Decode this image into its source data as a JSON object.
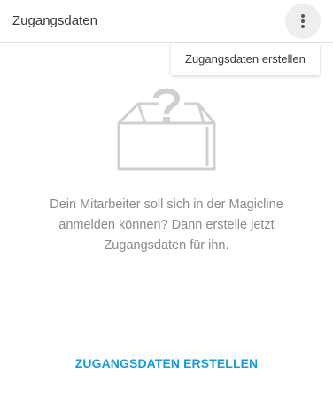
{
  "header": {
    "title": "Zugangsdaten",
    "menu_icon": "more-vertical-icon"
  },
  "dropdown": {
    "items": [
      {
        "label": "Zugangsdaten erstellen"
      }
    ]
  },
  "empty_state": {
    "icon": "empty-box-question-icon",
    "message_lines": [
      "Dein Mitarbeiter soll sich in der Magicline",
      "anmelden können? Dann erstelle jetzt",
      "Zugangsdaten für ihn."
    ],
    "action_label": "ZUGANGSDATEN ERSTELLEN"
  },
  "colors": {
    "accent": "#1a9ad6",
    "text_muted": "#8a8a8a",
    "illustration": "#d0d0d0"
  }
}
